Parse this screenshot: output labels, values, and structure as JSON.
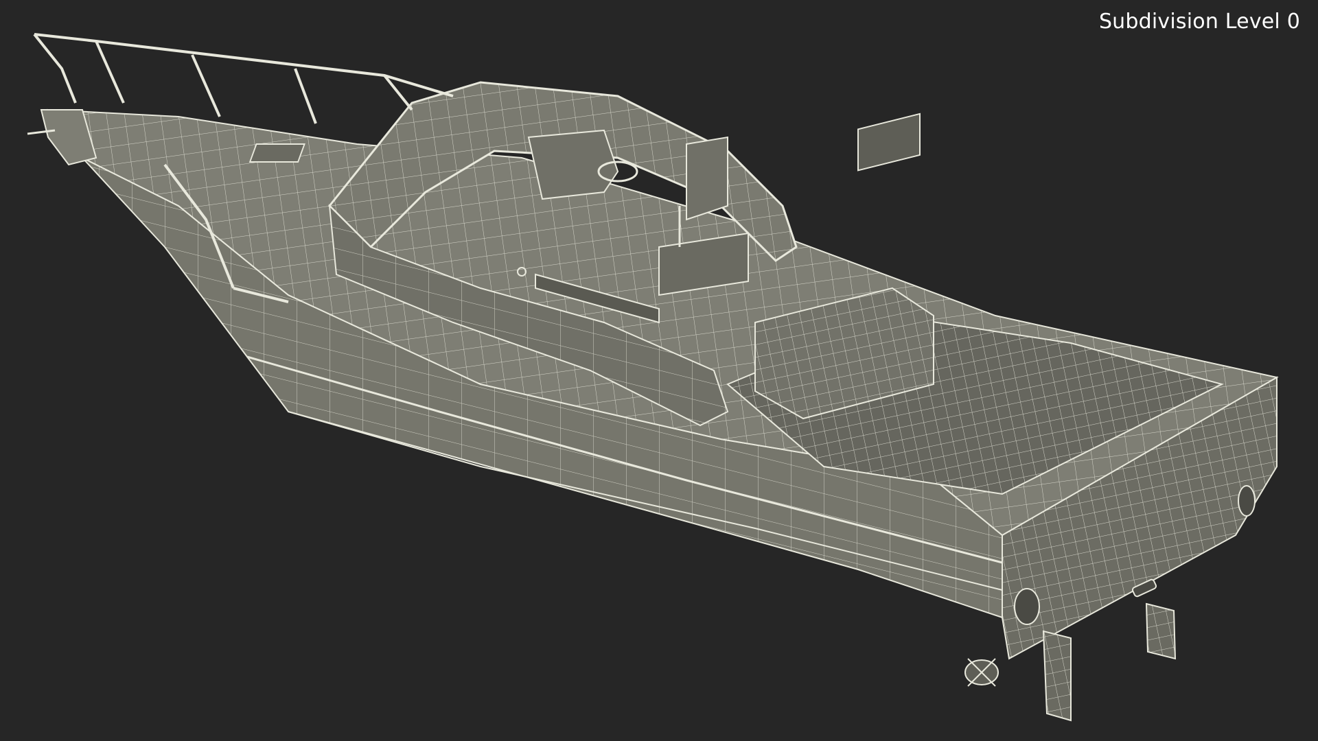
{
  "viewport": {
    "overlay_label": "Subdivision Level 0",
    "background_color": "#262626",
    "surface_color": "#76766c",
    "surface_shadow_color": "#5e5e56",
    "wire_color": "#e8e8dc"
  },
  "model": {
    "icon": "boat-wireframe-icon"
  }
}
